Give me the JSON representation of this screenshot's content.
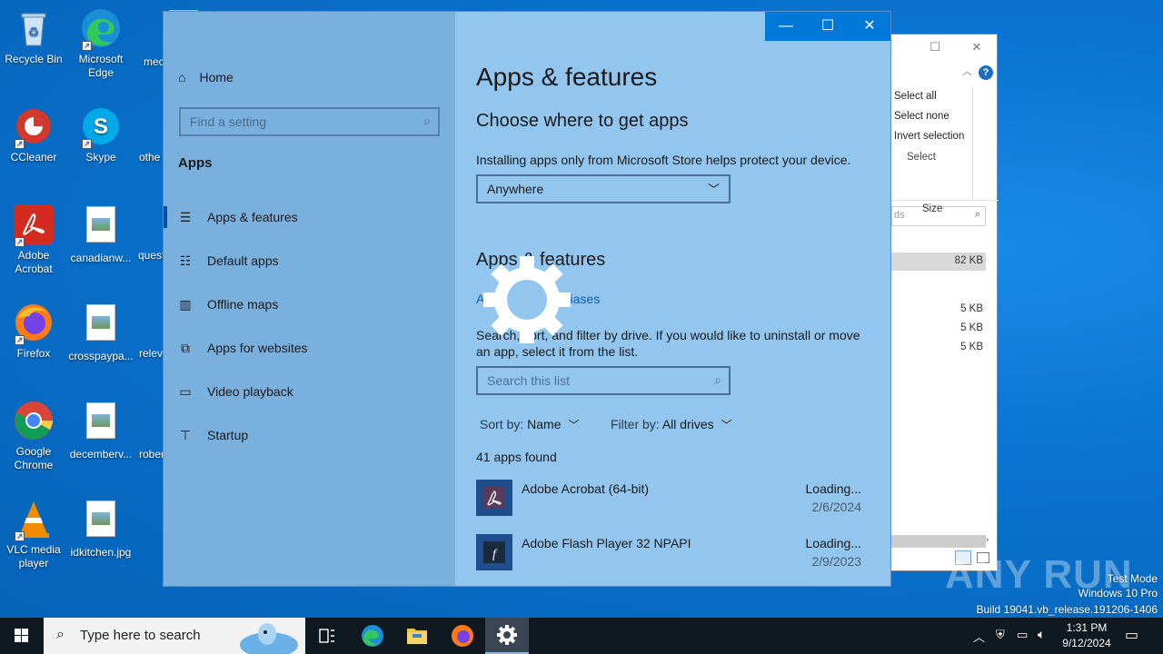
{
  "desktop": {
    "icons": [
      {
        "label": "Recycle Bin"
      },
      {
        "label": "Microsoft Edge"
      },
      {
        "label": "mec"
      },
      {
        "label": "CCleaner"
      },
      {
        "label": "Skype"
      },
      {
        "label": "othe"
      },
      {
        "label": "Adobe Acrobat"
      },
      {
        "label": "canadianw..."
      },
      {
        "label": "quest"
      },
      {
        "label": "Firefox"
      },
      {
        "label": "crosspaypa..."
      },
      {
        "label": "relev"
      },
      {
        "label": "Google Chrome"
      },
      {
        "label": "decemberv..."
      },
      {
        "label": "rober"
      },
      {
        "label": "VLC media player"
      },
      {
        "label": "idkitchen.jpg"
      }
    ]
  },
  "explorer": {
    "ribbon": [
      "Select all",
      "Select none",
      "Invert selection"
    ],
    "ribbon_group": "Select",
    "search_placeholder": "ds",
    "column_size": "Size",
    "rows": [
      "82 KB",
      "5 KB",
      "5 KB",
      "5 KB"
    ]
  },
  "settings": {
    "nav": {
      "home": "Home",
      "search_placeholder": "Find a setting",
      "section": "Apps",
      "items": [
        {
          "label": "Apps & features",
          "icon": "list-icon"
        },
        {
          "label": "Default apps",
          "icon": "default-apps-icon"
        },
        {
          "label": "Offline maps",
          "icon": "map-icon"
        },
        {
          "label": "Apps for websites",
          "icon": "link-icon"
        },
        {
          "label": "Video playback",
          "icon": "video-icon"
        },
        {
          "label": "Startup",
          "icon": "startup-icon"
        }
      ]
    },
    "content": {
      "title": "Apps & features",
      "choose_heading": "Choose where to get apps",
      "choose_desc": "Installing apps only from Microsoft Store helps protect your device.",
      "source_value": "Anywhere",
      "features_heading": "Apps & features",
      "aliases_link": "App execution aliases",
      "features_desc": "Search, sort, and filter by drive. If you would like to uninstall or move an app, select it from the list.",
      "search_placeholder": "Search this list",
      "sort_label": "Sort by:",
      "sort_value": "Name",
      "filter_label": "Filter by:",
      "filter_value": "All drives",
      "count": "41 apps found",
      "apps": [
        {
          "name": "Adobe Acrobat (64-bit)",
          "size": "Loading...",
          "date": "2/6/2024"
        },
        {
          "name": "Adobe Flash Player 32 NPAPI",
          "size": "Loading...",
          "date": "2/9/2023"
        }
      ]
    }
  },
  "taskbar": {
    "search_placeholder": "Type here to search",
    "time": "1:31 PM",
    "date": "9/12/2024"
  },
  "watermark": {
    "line1": "Test Mode",
    "line2": "Windows 10 Pro",
    "line3": "Build 19041.vb_release.191206-1406",
    "brand": "ANY RUN"
  }
}
